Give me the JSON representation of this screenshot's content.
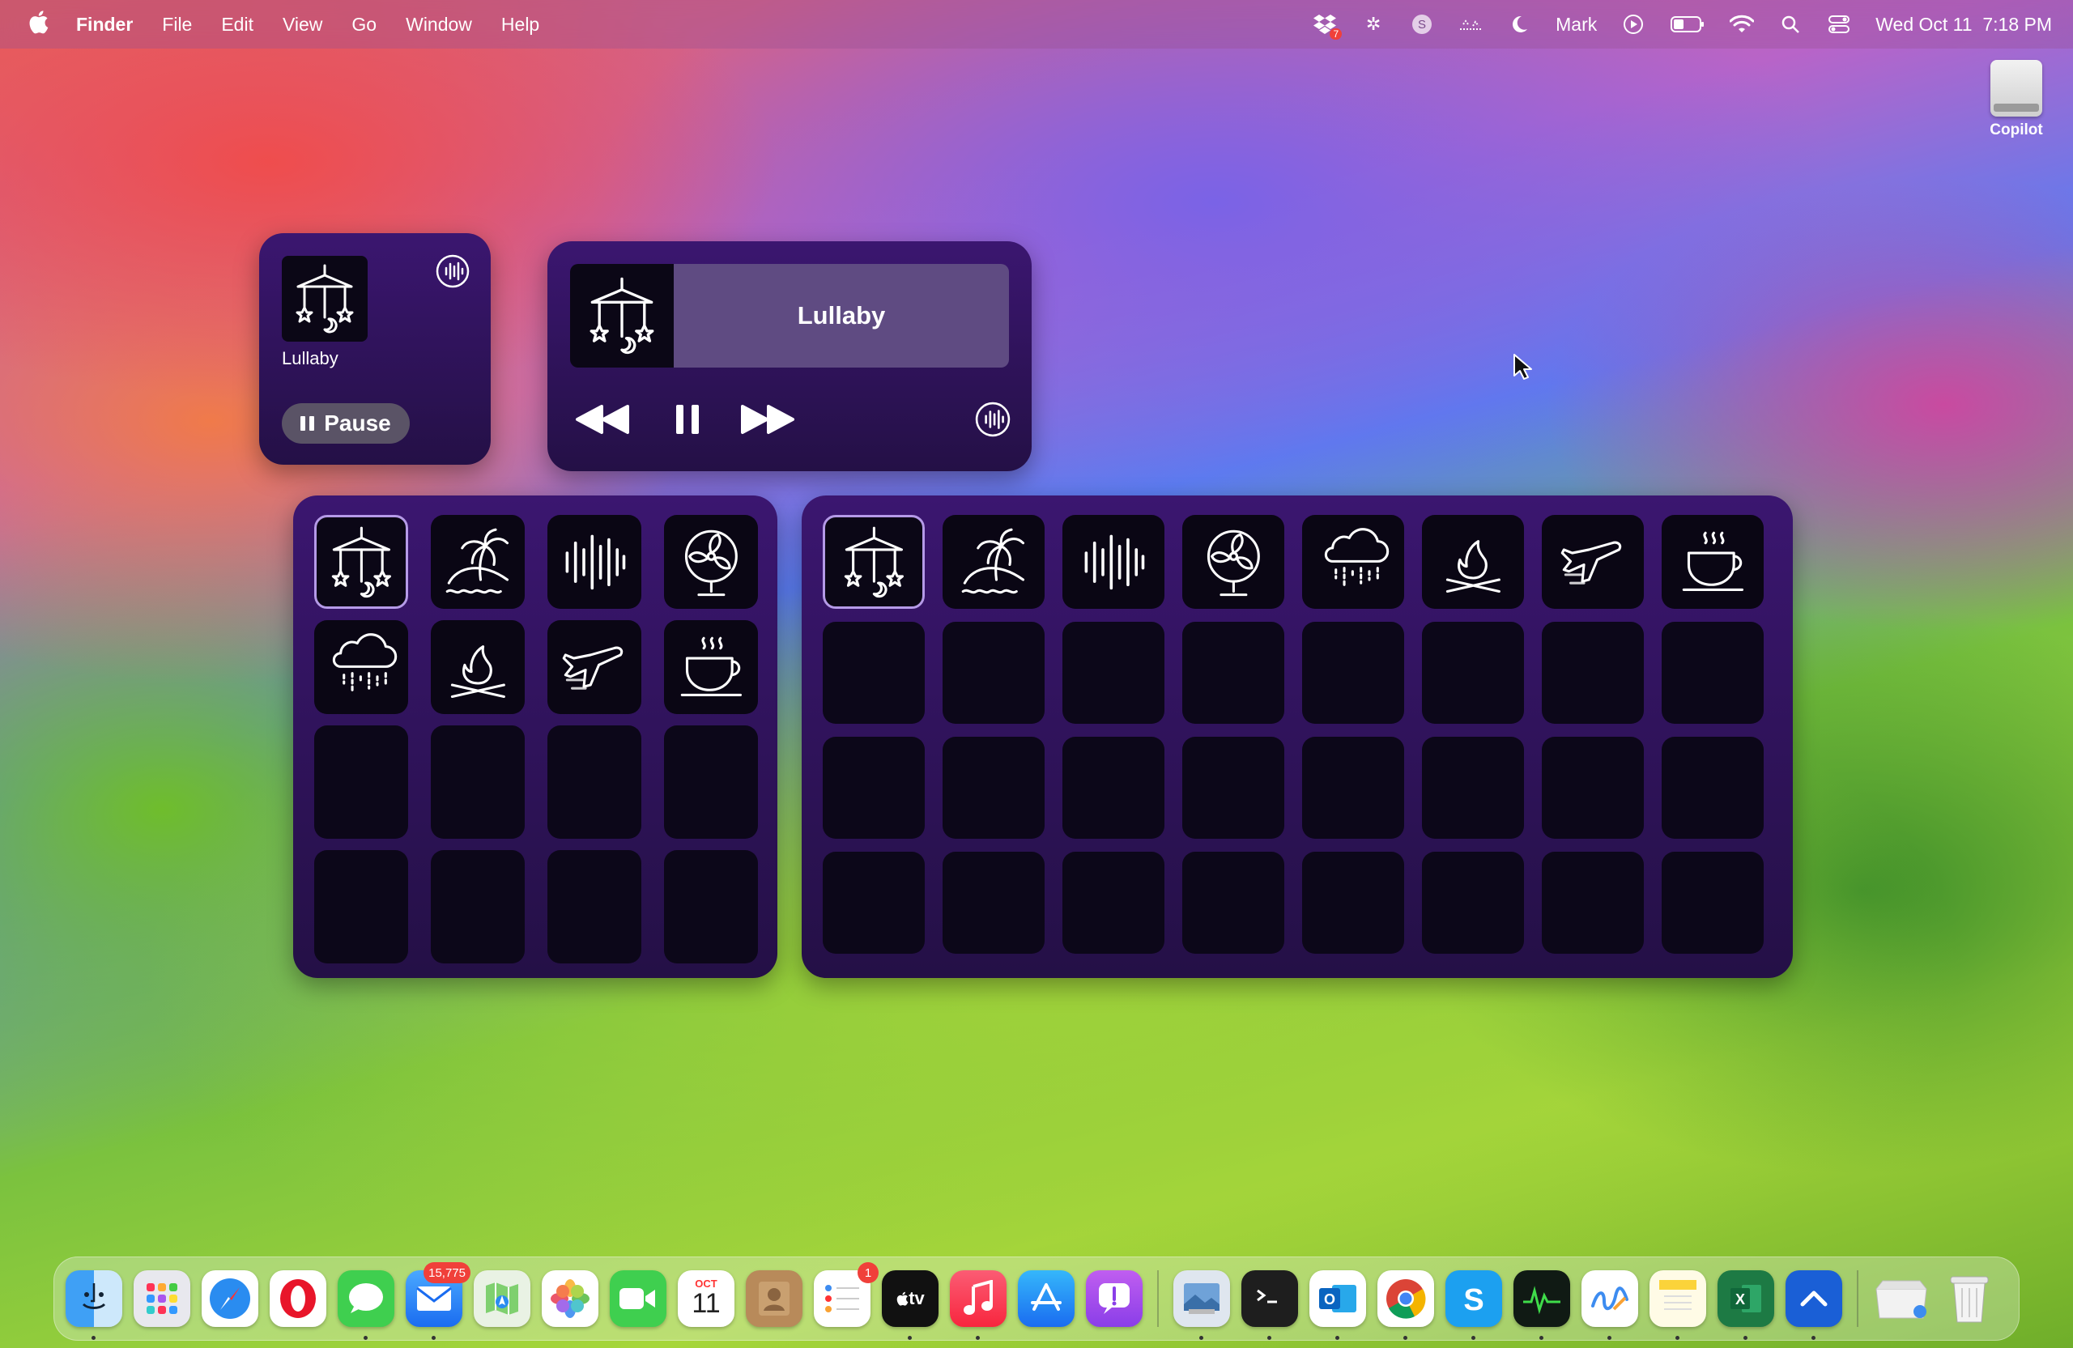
{
  "menubar": {
    "app": "Finder",
    "menus": [
      "File",
      "Edit",
      "View",
      "Go",
      "Window",
      "Help"
    ],
    "user": "Mark",
    "datetime": "Wed Oct 11  7:18 PM",
    "badge_count": "7"
  },
  "desktop": {
    "drive_label": "Copilot"
  },
  "small_widget": {
    "track": "Lullaby",
    "pause_label": "Pause"
  },
  "medium_widget": {
    "track": "Lullaby"
  },
  "sounds": [
    "lullaby",
    "island",
    "white-noise",
    "fan",
    "rain",
    "campfire",
    "airplane",
    "coffee-shop"
  ],
  "dock": {
    "mail_badge": "15,775",
    "calendar_month": "OCT",
    "calendar_day": "11",
    "reminders_badge": "1",
    "tv_label": "tv"
  },
  "colors": {
    "widget_bg": "#2e1259",
    "active_outline": "#b59ae8"
  }
}
